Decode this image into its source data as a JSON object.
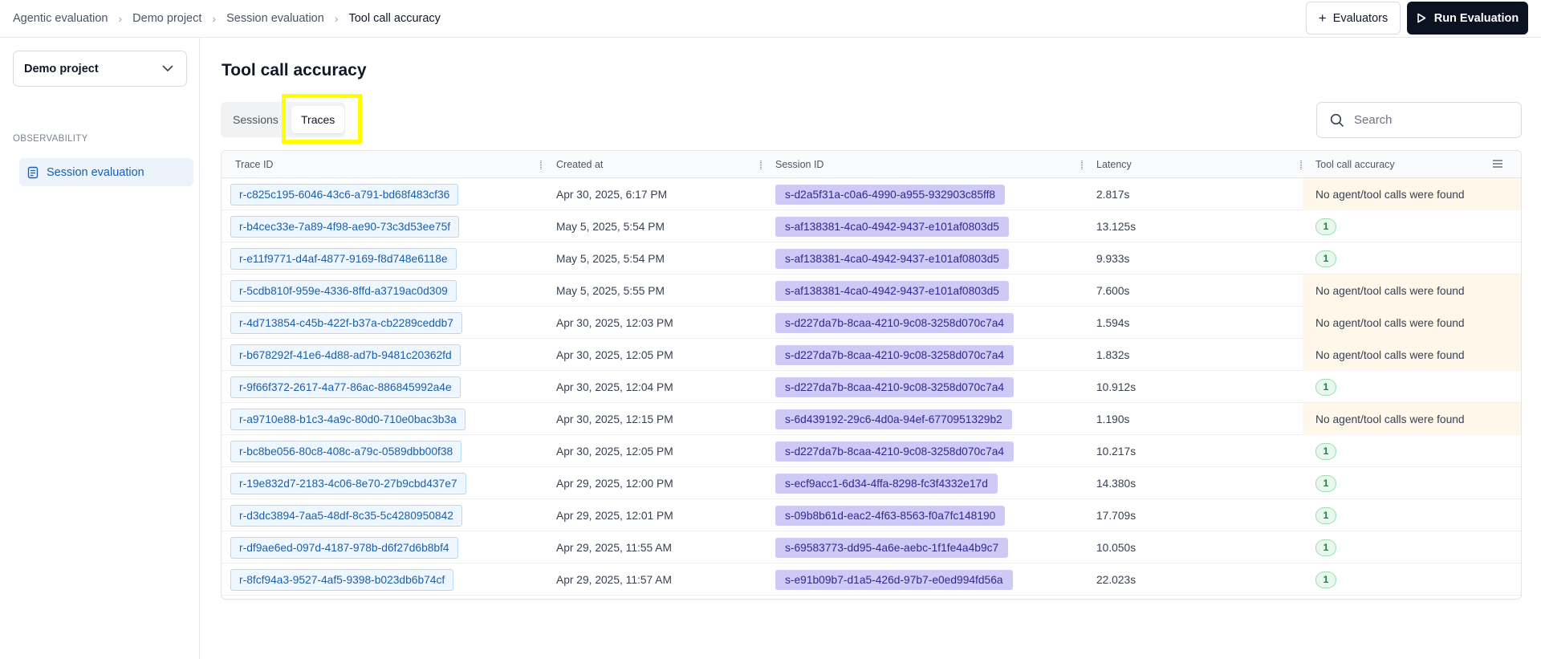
{
  "breadcrumb": [
    {
      "label": "Agentic evaluation"
    },
    {
      "label": "Demo project"
    },
    {
      "label": "Session evaluation"
    },
    {
      "label": "Tool call accuracy"
    }
  ],
  "header": {
    "evaluators_label": "Evaluators",
    "run_label": "Run Evaluation"
  },
  "sidebar": {
    "project": "Demo project",
    "section_label": "OBSERVABILITY",
    "items": [
      {
        "label": "Session evaluation",
        "icon": "document-icon"
      }
    ]
  },
  "main": {
    "title": "Tool call accuracy",
    "tabs": [
      {
        "label": "Sessions"
      },
      {
        "label": "Traces"
      }
    ],
    "active_tab": "Traces",
    "search_placeholder": "Search"
  },
  "table": {
    "columns": [
      "Trace ID",
      "Created at",
      "Session ID",
      "Latency",
      "Tool call accuracy"
    ],
    "rows": [
      {
        "trace": "r-c825c195-6046-43c6-a791-bd68f483cf36",
        "created": "Apr 30, 2025, 6:17 PM",
        "session": "s-d2a5f31a-c0a6-4990-a955-932903c85ff8",
        "latency": "2.817s",
        "accuracy": "No agent/tool calls were found"
      },
      {
        "trace": "r-b4cec33e-7a89-4f98-ae90-73c3d53ee75f",
        "created": "May 5, 2025, 5:54 PM",
        "session": "s-af138381-4ca0-4942-9437-e101af0803d5",
        "latency": "13.125s",
        "accuracy": "1"
      },
      {
        "trace": "r-e11f9771-d4af-4877-9169-f8d748e6118e",
        "created": "May 5, 2025, 5:54 PM",
        "session": "s-af138381-4ca0-4942-9437-e101af0803d5",
        "latency": "9.933s",
        "accuracy": "1"
      },
      {
        "trace": "r-5cdb810f-959e-4336-8ffd-a3719ac0d309",
        "created": "May 5, 2025, 5:55 PM",
        "session": "s-af138381-4ca0-4942-9437-e101af0803d5",
        "latency": "7.600s",
        "accuracy": "No agent/tool calls were found"
      },
      {
        "trace": "r-4d713854-c45b-422f-b37a-cb2289ceddb7",
        "created": "Apr 30, 2025, 12:03 PM",
        "session": "s-d227da7b-8caa-4210-9c08-3258d070c7a4",
        "latency": "1.594s",
        "accuracy": "No agent/tool calls were found"
      },
      {
        "trace": "r-b678292f-41e6-4d88-ad7b-9481c20362fd",
        "created": "Apr 30, 2025, 12:05 PM",
        "session": "s-d227da7b-8caa-4210-9c08-3258d070c7a4",
        "latency": "1.832s",
        "accuracy": "No agent/tool calls were found"
      },
      {
        "trace": "r-9f66f372-2617-4a77-86ac-886845992a4e",
        "created": "Apr 30, 2025, 12:04 PM",
        "session": "s-d227da7b-8caa-4210-9c08-3258d070c7a4",
        "latency": "10.912s",
        "accuracy": "1"
      },
      {
        "trace": "r-a9710e88-b1c3-4a9c-80d0-710e0bac3b3a",
        "created": "Apr 30, 2025, 12:15 PM",
        "session": "s-6d439192-29c6-4d0a-94ef-6770951329b2",
        "latency": "1.190s",
        "accuracy": "No agent/tool calls were found"
      },
      {
        "trace": "r-bc8be056-80c8-408c-a79c-0589dbb00f38",
        "created": "Apr 30, 2025, 12:05 PM",
        "session": "s-d227da7b-8caa-4210-9c08-3258d070c7a4",
        "latency": "10.217s",
        "accuracy": "1"
      },
      {
        "trace": "r-19e832d7-2183-4c06-8e70-27b9cbd437e7",
        "created": "Apr 29, 2025, 12:00 PM",
        "session": "s-ecf9acc1-6d34-4ffa-8298-fc3f4332e17d",
        "latency": "14.380s",
        "accuracy": "1"
      },
      {
        "trace": "r-d3dc3894-7aa5-48df-8c35-5c4280950842",
        "created": "Apr 29, 2025, 12:01 PM",
        "session": "s-09b8b61d-eac2-4f63-8563-f0a7fc148190",
        "latency": "17.709s",
        "accuracy": "1"
      },
      {
        "trace": "r-df9ae6ed-097d-4187-978b-d6f27d6b8bf4",
        "created": "Apr 29, 2025, 11:55 AM",
        "session": "s-69583773-dd95-4a6e-aebc-1f1fe4a4b9c7",
        "latency": "10.050s",
        "accuracy": "1"
      },
      {
        "trace": "r-8fcf94a3-9527-4af5-9398-b023db6b74cf",
        "created": "Apr 29, 2025, 11:57 AM",
        "session": "s-e91b09b7-d1a5-426d-97b7-e0ed994fd56a",
        "latency": "22.023s",
        "accuracy": "1"
      }
    ]
  },
  "colors": {
    "highlight": "#ffff00",
    "primary_button": "#0b1220",
    "session_pill": "#cfc9f5",
    "trace_pill": "#eef6ff",
    "warn_cell": "#fff8ea",
    "success_badge": "#e7f7ec"
  }
}
